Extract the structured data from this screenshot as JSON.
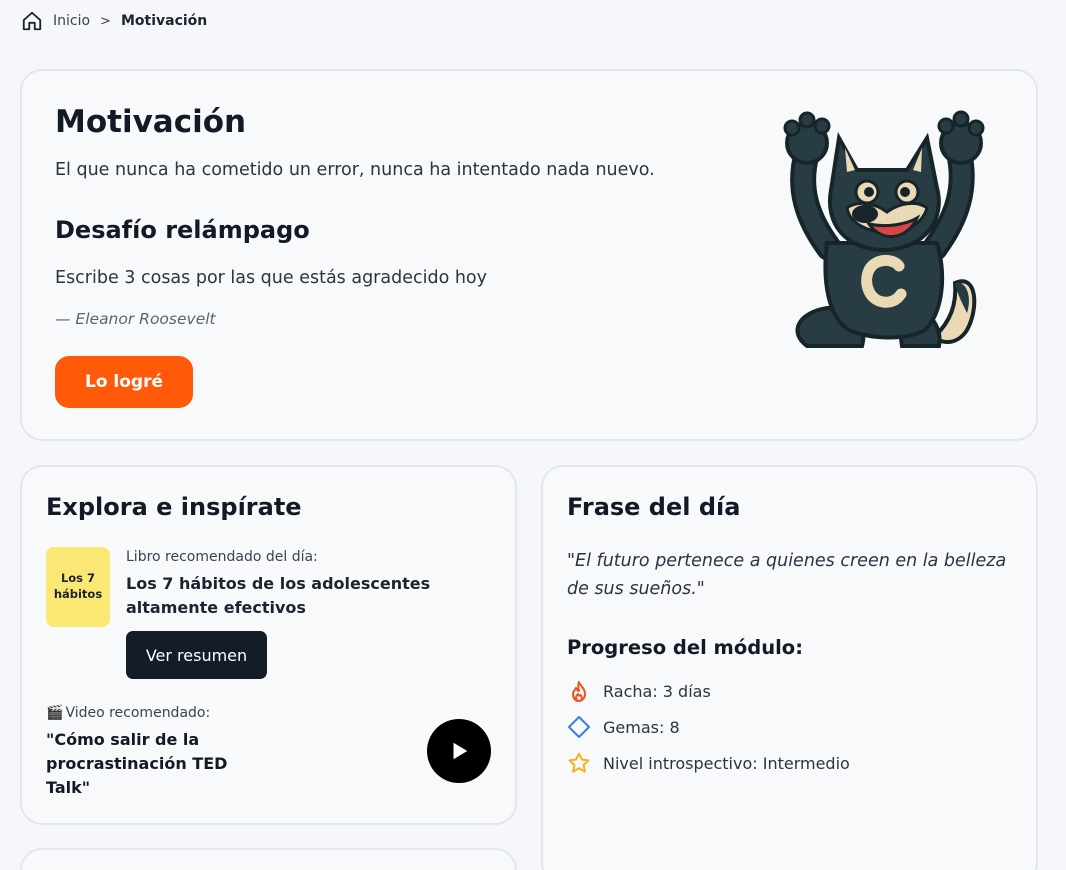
{
  "breadcrumb": {
    "home": "Inicio",
    "separator": ">",
    "current": "Motivación"
  },
  "hero": {
    "title": "Motivación",
    "subtitle": "El que nunca ha cometido un error, nunca ha intentado nada nuevo.",
    "challenge_title": "Desafío relámpago",
    "challenge_text": "Escribe 3 cosas por las que estás agradecido hoy",
    "author": "— Eleanor Roosevelt",
    "button": "Lo logré",
    "mascot_letter": "C"
  },
  "explore": {
    "title": "Explora e inspírate",
    "book": {
      "cover": "Los 7 hábitos",
      "label": "Libro recomendado del día:",
      "title": "Los 7 hábitos de los adolescentes altamente efectivos",
      "button": "Ver resumen"
    },
    "video": {
      "emoji": "🎬",
      "label": "Video recomendado:",
      "title": "\"Cómo salir de la procrastinación TED Talk\""
    }
  },
  "phrase": {
    "title": "Frase del día",
    "quote": "\"El futuro pertenece a quienes creen en la belleza de sus sueños.\"",
    "progress_title": "Progreso del módulo:",
    "stats": [
      {
        "icon": "flame-icon",
        "text": "Racha: 3 días"
      },
      {
        "icon": "diamond-icon",
        "text": "Gemas: 8"
      },
      {
        "icon": "star-icon",
        "text": "Nivel introspectivo: Intermedio"
      }
    ]
  },
  "colors": {
    "accent": "#ff5a0a",
    "dark_button": "#141c28",
    "book_cover": "#fbe774",
    "flame": "#f0541e",
    "diamond": "#3b7fe0",
    "star": "#f2b318"
  }
}
